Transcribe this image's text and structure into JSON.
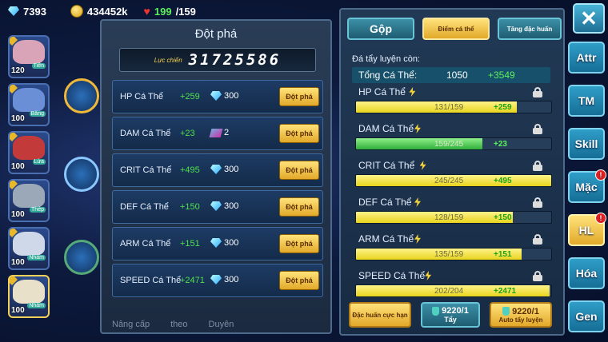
{
  "topbar": {
    "gems": "7393",
    "coins": "434452k",
    "stamina_current": "199",
    "stamina_max": "/159"
  },
  "roster": [
    {
      "level": "120",
      "tag": "Tiên",
      "tag2": "Nhàm",
      "color": "#d9a3b8"
    },
    {
      "level": "100",
      "tag": "Băng",
      "tag2": "Nước",
      "color": "#6a8fd6"
    },
    {
      "level": "100",
      "tag": "Lửa",
      "tag2": "Đất",
      "color": "#c23a3a"
    },
    {
      "level": "100",
      "tag": "Thép",
      "tag2": "Nhàm",
      "color": "#9aa8b8"
    },
    {
      "level": "100",
      "tag": "Nhàm",
      "tag2": "Băng",
      "color": "#cfd8e8"
    },
    {
      "level": "100",
      "tag": "Nhàm",
      "tag2": "",
      "color": "#e8e0c8"
    }
  ],
  "left_panel": {
    "title": "Đột phá",
    "power_label": "Lực chiến",
    "power_value": "31725586",
    "rows": [
      {
        "name": "HP Cá Thể",
        "inc": "+259",
        "cost": "300",
        "icon": "gem-icon",
        "button": "Đột phá"
      },
      {
        "name": "DAM Cá Thể",
        "inc": "+23",
        "cost": "2",
        "icon": "book-icon",
        "button": "Đột phá"
      },
      {
        "name": "CRIT Cá Thể",
        "inc": "+495",
        "cost": "300",
        "icon": "gem-icon",
        "button": "Đột phá"
      },
      {
        "name": "DEF Cá Thể",
        "inc": "+150",
        "cost": "300",
        "icon": "gem-icon",
        "button": "Đột phá"
      },
      {
        "name": "ARM Cá Thể",
        "inc": "+151",
        "cost": "300",
        "icon": "gem-icon",
        "button": "Đột phá"
      },
      {
        "name": "SPEED Cá Thể",
        "inc": "+2471",
        "cost": "300",
        "icon": "gem-icon",
        "button": "Đột phá"
      }
    ]
  },
  "right_panel": {
    "tabs": [
      "Gộp",
      "Điểm cá thể",
      "Tăng đặc huấn"
    ],
    "header": "Đá tẩy luyện còn:",
    "total_label": "Tổng Cá Thể:",
    "total_value": "1050",
    "total_add": "+3549",
    "stats": [
      {
        "name": "HP Cá Thể",
        "cur": "131/159",
        "add": "+259",
        "fill": 0.824,
        "green": false
      },
      {
        "name": "DAM Cá Thể",
        "cur": "159/245",
        "add": "+23",
        "fill": 0.649,
        "green": true
      },
      {
        "name": "CRIT Cá Thể",
        "cur": "245/245",
        "add": "+495",
        "fill": 1.0,
        "green": false
      },
      {
        "name": "DEF Cá Thể",
        "cur": "128/159",
        "add": "+150",
        "fill": 0.805,
        "green": false
      },
      {
        "name": "ARM Cá Thể",
        "cur": "135/159",
        "add": "+151",
        "fill": 0.849,
        "green": false
      },
      {
        "name": "SPEED Cá Thể",
        "cur": "202/204",
        "add": "+2471",
        "fill": 0.99,
        "green": false
      }
    ],
    "bottom_buttons": [
      {
        "label": "Đặc huấn cực hạn",
        "count": ""
      },
      {
        "label": "Tẩy",
        "count": "9220/1"
      },
      {
        "label": "Auto tẩy luyện",
        "count": "9220/1"
      }
    ]
  },
  "nav": [
    {
      "label": "Attr",
      "badge": ""
    },
    {
      "label": "TM",
      "badge": ""
    },
    {
      "label": "Skill",
      "badge": ""
    },
    {
      "label": "Mặc",
      "badge": "!"
    },
    {
      "label": "HL",
      "badge": "!"
    },
    {
      "label": "Hóa",
      "badge": ""
    },
    {
      "label": "Gen",
      "badge": ""
    }
  ],
  "close_label": "✕",
  "bottom_labels": [
    "Nâng cấp",
    "theo",
    "Duyên"
  ]
}
